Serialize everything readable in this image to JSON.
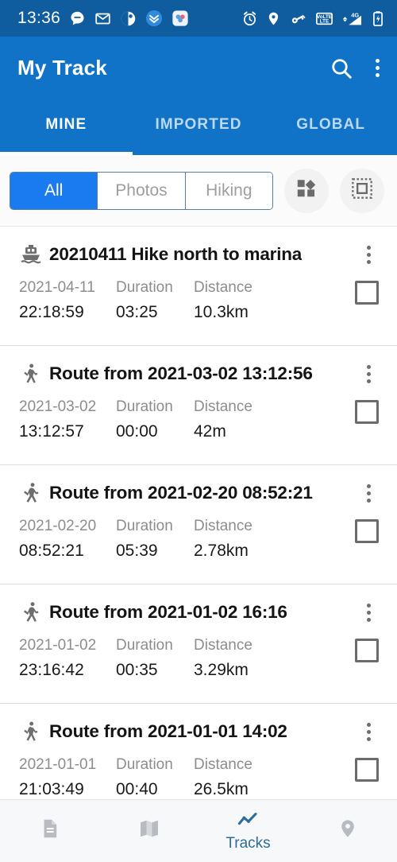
{
  "statusbar": {
    "time": "13:36",
    "left_icons": [
      "chat-bubble-icon",
      "envelope-icon",
      "app-badge-icon",
      "chevron-double-down-icon",
      "app-cluster-icon"
    ],
    "right_icons": [
      "alarm-clock-icon",
      "location-pin-icon",
      "vpn-key-icon",
      "volte-icon",
      "signal-4g-icon",
      "battery-icon"
    ],
    "volte_label_top": "VoLTE",
    "network_label": "4G",
    "bg_color": "#0F5C9E"
  },
  "appbar": {
    "title": "My Track",
    "search_icon": "search-icon",
    "overflow_icon": "more-vertical-icon",
    "bg_color": "#1173C8"
  },
  "tabs": {
    "items": [
      {
        "label": "MINE",
        "active": true
      },
      {
        "label": "IMPORTED",
        "active": false
      },
      {
        "label": "GLOBAL",
        "active": false
      }
    ]
  },
  "filterbar": {
    "segments": [
      {
        "label": "All",
        "active": true
      },
      {
        "label": "Photos",
        "active": false
      },
      {
        "label": "Hiking",
        "active": false
      }
    ],
    "buttons": [
      {
        "icon": "shapes-grid-icon"
      },
      {
        "icon": "select-area-icon"
      }
    ],
    "active_color": "#1A7AF0"
  },
  "list": {
    "labels": {
      "duration": "Duration",
      "distance": "Distance"
    },
    "rows": [
      {
        "icon": "ferry-boat-icon",
        "title": "20210411 Hike north to marina",
        "date": "2021-04-11",
        "time": "22:18:59",
        "duration_label": "Duration",
        "duration": "03:25",
        "distance_label": "Distance",
        "distance": "10.3km",
        "checked": false
      },
      {
        "icon": "walking-icon",
        "title": "Route from 2021-03-02 13:12:56",
        "date": "2021-03-02",
        "time": "13:12:57",
        "duration_label": "Duration",
        "duration": "00:00",
        "distance_label": "Distance",
        "distance": "42m",
        "checked": false
      },
      {
        "icon": "running-icon",
        "title": "Route from 2021-02-20 08:52:21",
        "date": "2021-02-20",
        "time": "08:52:21",
        "duration_label": "Duration",
        "duration": "05:39",
        "distance_label": "Distance",
        "distance": "2.78km",
        "checked": false
      },
      {
        "icon": "running-icon",
        "title": "Route from 2021-01-02 16:16",
        "date": "2021-01-02",
        "time": "23:16:42",
        "duration_label": "Duration",
        "duration": "00:35",
        "distance_label": "Distance",
        "distance": "3.29km",
        "checked": false
      },
      {
        "icon": "walking-icon",
        "title": "Route from 2021-01-01 14:02",
        "date": "2021-01-01",
        "time": "21:03:49",
        "duration_label": "Duration",
        "duration": "00:40",
        "distance_label": "Distance",
        "distance": "26.5km",
        "checked": false
      }
    ]
  },
  "bottomnav": {
    "items": [
      {
        "icon": "document-icon",
        "label": "",
        "active": false
      },
      {
        "icon": "map-icon",
        "label": "",
        "active": false
      },
      {
        "icon": "tracks-chart-icon",
        "label": "Tracks",
        "active": true
      },
      {
        "icon": "location-pin-icon",
        "label": "",
        "active": false
      }
    ],
    "active_color": "#2E6C99"
  }
}
